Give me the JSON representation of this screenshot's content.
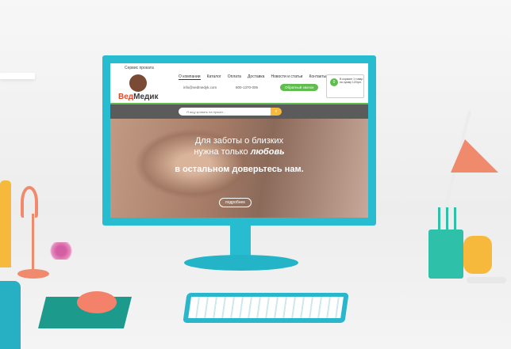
{
  "site": {
    "service_label": "Сервис проката",
    "logo_part1": "Вед",
    "logo_part2": "Медик",
    "nav": [
      "О компании",
      "Каталог",
      "Оплата",
      "Доставка",
      "Новости и статьи",
      "Контакты"
    ],
    "email": "info@vedmedyk.com",
    "phone": "800-1370-006",
    "callback_label": "Обратный звонок",
    "cart": {
      "count": "0",
      "text": "В корзине 1 товар на сумму 120грн."
    },
    "search_placeholder": "Я ищу кровать на прокат...",
    "search_icon": "search-icon",
    "hero": {
      "line1": "Для заботы о близких",
      "line2_prefix": "нужна только ",
      "line2_emph": "любовь",
      "line3": "в остальном доверьтесь нам."
    },
    "more_label": "подробнее"
  },
  "colors": {
    "accent": "#5fbd4e",
    "brand": "#e14a2c",
    "monitor": "#27bcd0",
    "search_btn": "#f6b93b"
  }
}
